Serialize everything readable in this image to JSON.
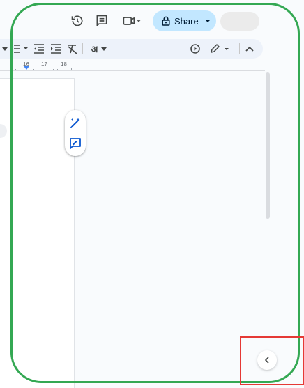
{
  "header": {
    "share_label": "Share",
    "icons": [
      "history-icon",
      "comments-icon",
      "meet-icon",
      "lock-icon",
      "chevron-down-icon"
    ]
  },
  "toolbar": {
    "input_tools_label": "अ",
    "icons": [
      "numbered-list-icon",
      "decrease-indent-icon",
      "increase-indent-icon",
      "clear-formatting-icon",
      "input-tools-icon",
      "voice-typing-icon",
      "editing-mode-icon",
      "collapse-menus-icon"
    ]
  },
  "ruler": {
    "numbers": [
      "16",
      "17",
      "18"
    ]
  },
  "colors": {
    "share_bg": "#c2e7ff",
    "accent_blue": "#0b57d0",
    "frame_green": "#34a853",
    "highlight_red": "#e53935"
  }
}
